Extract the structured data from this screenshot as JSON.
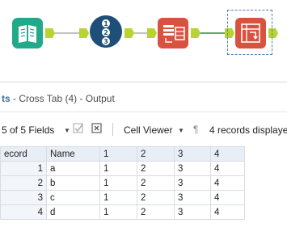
{
  "results_title": {
    "prefix": "ts",
    "text": " - Cross Tab (4) - Output"
  },
  "toolbar": {
    "fields_label": "5 of 5 Fields",
    "cell_viewer_label": "Cell Viewer",
    "records_label": "4 records displaye"
  },
  "table": {
    "columns": [
      "ecord",
      "Name",
      "1",
      "2",
      "3",
      "4"
    ],
    "rows": [
      [
        "1",
        "a",
        "1",
        "2",
        "3",
        "4"
      ],
      [
        "2",
        "b",
        "1",
        "2",
        "3",
        "4"
      ],
      [
        "3",
        "c",
        "1",
        "2",
        "3",
        "4"
      ],
      [
        "4",
        "d",
        "1",
        "2",
        "3",
        "4"
      ]
    ]
  },
  "colors": {
    "input_tool": "#22a98a",
    "record_id_tool": "#1d4f79",
    "transform_tool": "#d9523f",
    "connector": "#b9d332",
    "selection_border": "#4d80b5"
  }
}
